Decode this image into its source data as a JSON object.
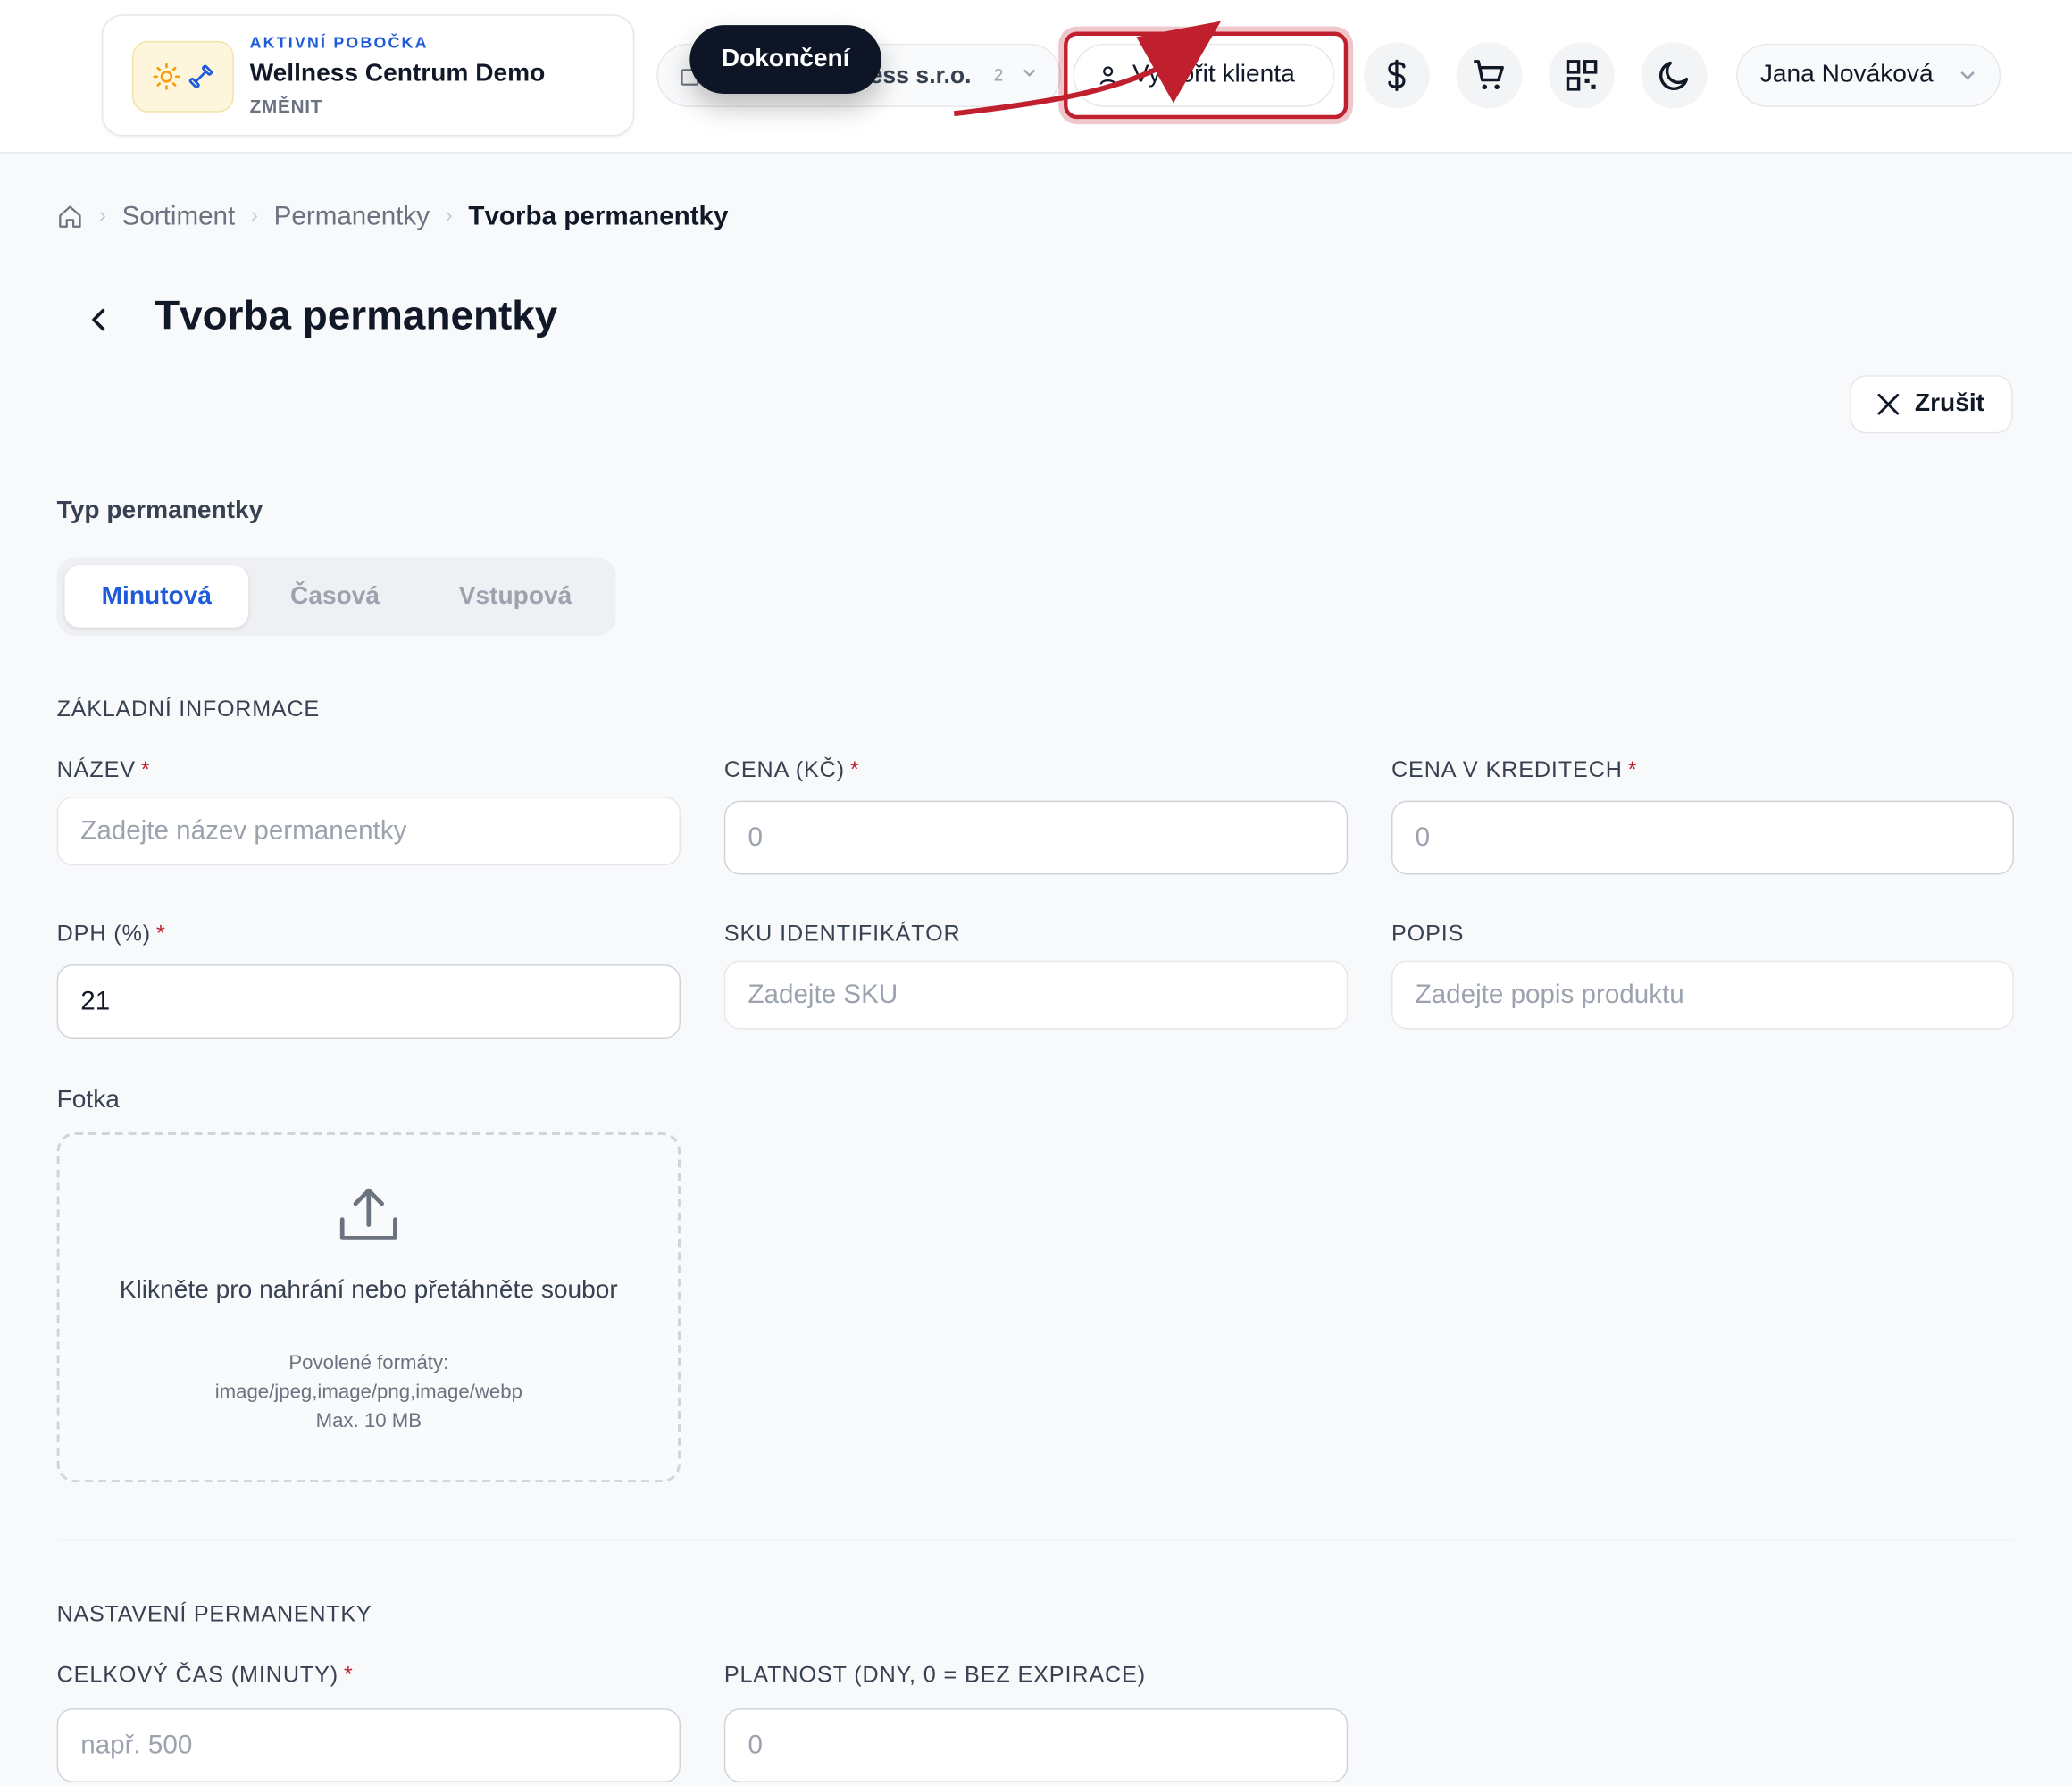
{
  "header": {
    "branch": {
      "kicker": "AKTIVNÍ POBOČKA",
      "name": "Wellness Centrum Demo",
      "change_label": "ZMĚNIT"
    },
    "company": {
      "name_partial": "ess s.r.o.",
      "count": "2"
    },
    "tooltip": "Dokončení",
    "create_client_label": "Vytvořit klienta",
    "icons": [
      "dollar-icon",
      "cart-icon",
      "qr-code-icon",
      "moon-icon"
    ],
    "user_name": "Jana Nováková",
    "accent_color": "#1d5bd8",
    "highlight_color": "#c0202e"
  },
  "breadcrumb": {
    "items": [
      "Sortiment",
      "Permanentky"
    ],
    "current": "Tvorba permanentky"
  },
  "page": {
    "title": "Tvorba permanentky",
    "cancel_label": "Zrušit"
  },
  "type": {
    "label": "Typ permanentky",
    "options": [
      "Minutová",
      "Časová",
      "Vstupová"
    ],
    "selected": "Minutová"
  },
  "basic": {
    "section": "ZÁKLADNÍ INFORMACE",
    "name": {
      "label": "NÁZEV",
      "placeholder": "Zadejte název permanentky"
    },
    "price": {
      "label": "CENA (KČ)",
      "value": "0"
    },
    "credits": {
      "label": "CENA V KREDITECH",
      "value": "0"
    },
    "vat": {
      "label": "DPH (%)",
      "value": "21"
    },
    "sku": {
      "label": "SKU IDENTIFIKÁTOR",
      "placeholder": "Zadejte SKU"
    },
    "description": {
      "label": "POPIS",
      "placeholder": "Zadejte popis produktu"
    },
    "required_mark": "*"
  },
  "photo": {
    "label": "Fotka",
    "main": "Klikněte pro nahrání nebo přetáhněte soubor",
    "formats_label": "Povolené formáty:",
    "formats": "image/jpeg,image/png,image/webp",
    "max": "Max. 10 MB"
  },
  "settings": {
    "section": "NASTAVENÍ PERMANENTKY",
    "total_time": {
      "label": "CELKOVÝ ČAS (MINUTY)",
      "placeholder": "např. 500"
    },
    "validity": {
      "label": "PLATNOST (DNY, 0 = BEZ EXPIRACE)",
      "value": "0"
    }
  }
}
